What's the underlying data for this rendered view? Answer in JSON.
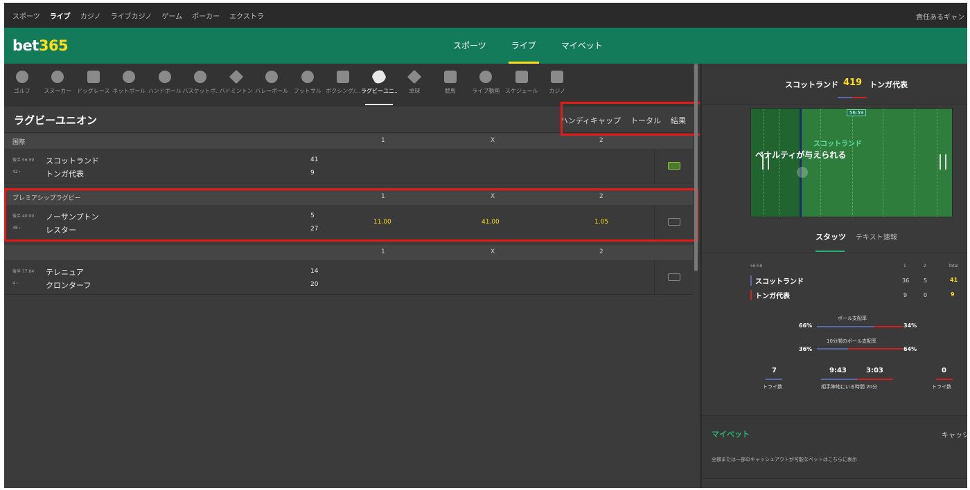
{
  "topnav": {
    "items": [
      "スポーツ",
      "ライブ",
      "カジノ",
      "ライブカジノ",
      "ゲーム",
      "ポーカー",
      "エクストラ"
    ],
    "right": "責任あるギャン"
  },
  "header": {
    "logo_main": "bet",
    "logo_accent": "365",
    "nav": [
      "スポーツ",
      "ライブ",
      "マイベット"
    ]
  },
  "sports": [
    {
      "label": "ゴルフ",
      "icon": "golf-icon"
    },
    {
      "label": "スヌーカー",
      "icon": "snooker-icon"
    },
    {
      "label": "ドッグレース",
      "icon": "greyhound-icon"
    },
    {
      "label": "ネットボール",
      "icon": "netball-icon"
    },
    {
      "label": "ハンドボール",
      "icon": "handball-icon"
    },
    {
      "label": "バスケットボ...",
      "icon": "basketball-icon"
    },
    {
      "label": "バドミントン",
      "icon": "badminton-icon"
    },
    {
      "label": "バレーボール",
      "icon": "volleyball-icon"
    },
    {
      "label": "フットサル",
      "icon": "futsal-icon"
    },
    {
      "label": "ボクシング/...",
      "icon": "boxing-icon"
    },
    {
      "label": "ラグビーユニ...",
      "icon": "rugby-icon"
    },
    {
      "label": "卓球",
      "icon": "table-tennis-icon"
    },
    {
      "label": "競馬",
      "icon": "horse-racing-icon"
    },
    {
      "label": "ライブ動画",
      "icon": "live-stream-icon"
    },
    {
      "label": "スケジュール",
      "icon": "schedule-icon"
    },
    {
      "label": "カジノ",
      "icon": "casino-icon"
    }
  ],
  "main": {
    "title": "ラグビーユニオン",
    "market_tabs": [
      "ハンディキャップ",
      "トータル",
      "結果"
    ],
    "col_headers": {
      "one": "1",
      "x": "X",
      "two": "2"
    },
    "groups": [
      {
        "label": "国際",
        "match": {
          "time1": "後半 56:59",
          "time2": "42 ›",
          "team1": "スコットランド",
          "team2": "トンガ代表",
          "score1": "41",
          "score2": "9",
          "odd1": "",
          "oddx": "",
          "odd2": ""
        }
      },
      {
        "label": "プレミアシップラグビー",
        "match": {
          "time1": "後半 40:00",
          "time2": "48 ›",
          "team1": "ノーサンプトン",
          "team2": "レスター",
          "score1": "5",
          "score2": "27",
          "odd1": "11.00",
          "oddx": "41.00",
          "odd2": "1.05"
        }
      },
      {
        "label": "",
        "match": {
          "time1": "後半 77:04",
          "time2": "4 ›",
          "team1": "テレニュア",
          "team2": "クロンターフ",
          "score1": "14",
          "score2": "20",
          "odd1": "",
          "oddx": "",
          "odd2": ""
        }
      }
    ]
  },
  "panel": {
    "team1": "スコットランド",
    "team2": "トンガ代表",
    "score1": "41",
    "score2": "9",
    "clock": "56:59",
    "field_team": "スコットランド",
    "field_event": "ペナルティが与えられる",
    "tabs": [
      "スタッツ",
      "テキスト速報"
    ],
    "stats_cols": [
      "1",
      "2",
      "Total"
    ],
    "team1_vals": [
      "36",
      "5",
      "41"
    ],
    "team2_vals": [
      "9",
      "0",
      "9"
    ],
    "possession_label": "ボール支配率",
    "possession_1": "66%",
    "possession_2": "34%",
    "possession10_label": "10分間のボール支配率",
    "possession10_1": "36%",
    "possession10_2": "64%",
    "tries_1": "7",
    "tries_2": "0",
    "tries_label": "トライ数",
    "territory_1": "9:43",
    "territory_2": "3:03",
    "territory_label": "相手陣地にいる時間 20分",
    "mybet_title": "マイベット",
    "mybet_right": "キャッシ",
    "mybet_desc": "全額または一部のキャッシュアウトが可能なベットはこちらに表示",
    "colors": {
      "green": "#137a5a",
      "yellow": "#ffdf1b",
      "team1": "#5a6aa8",
      "team2": "#d02020",
      "highlight": "#e41b1b"
    }
  }
}
